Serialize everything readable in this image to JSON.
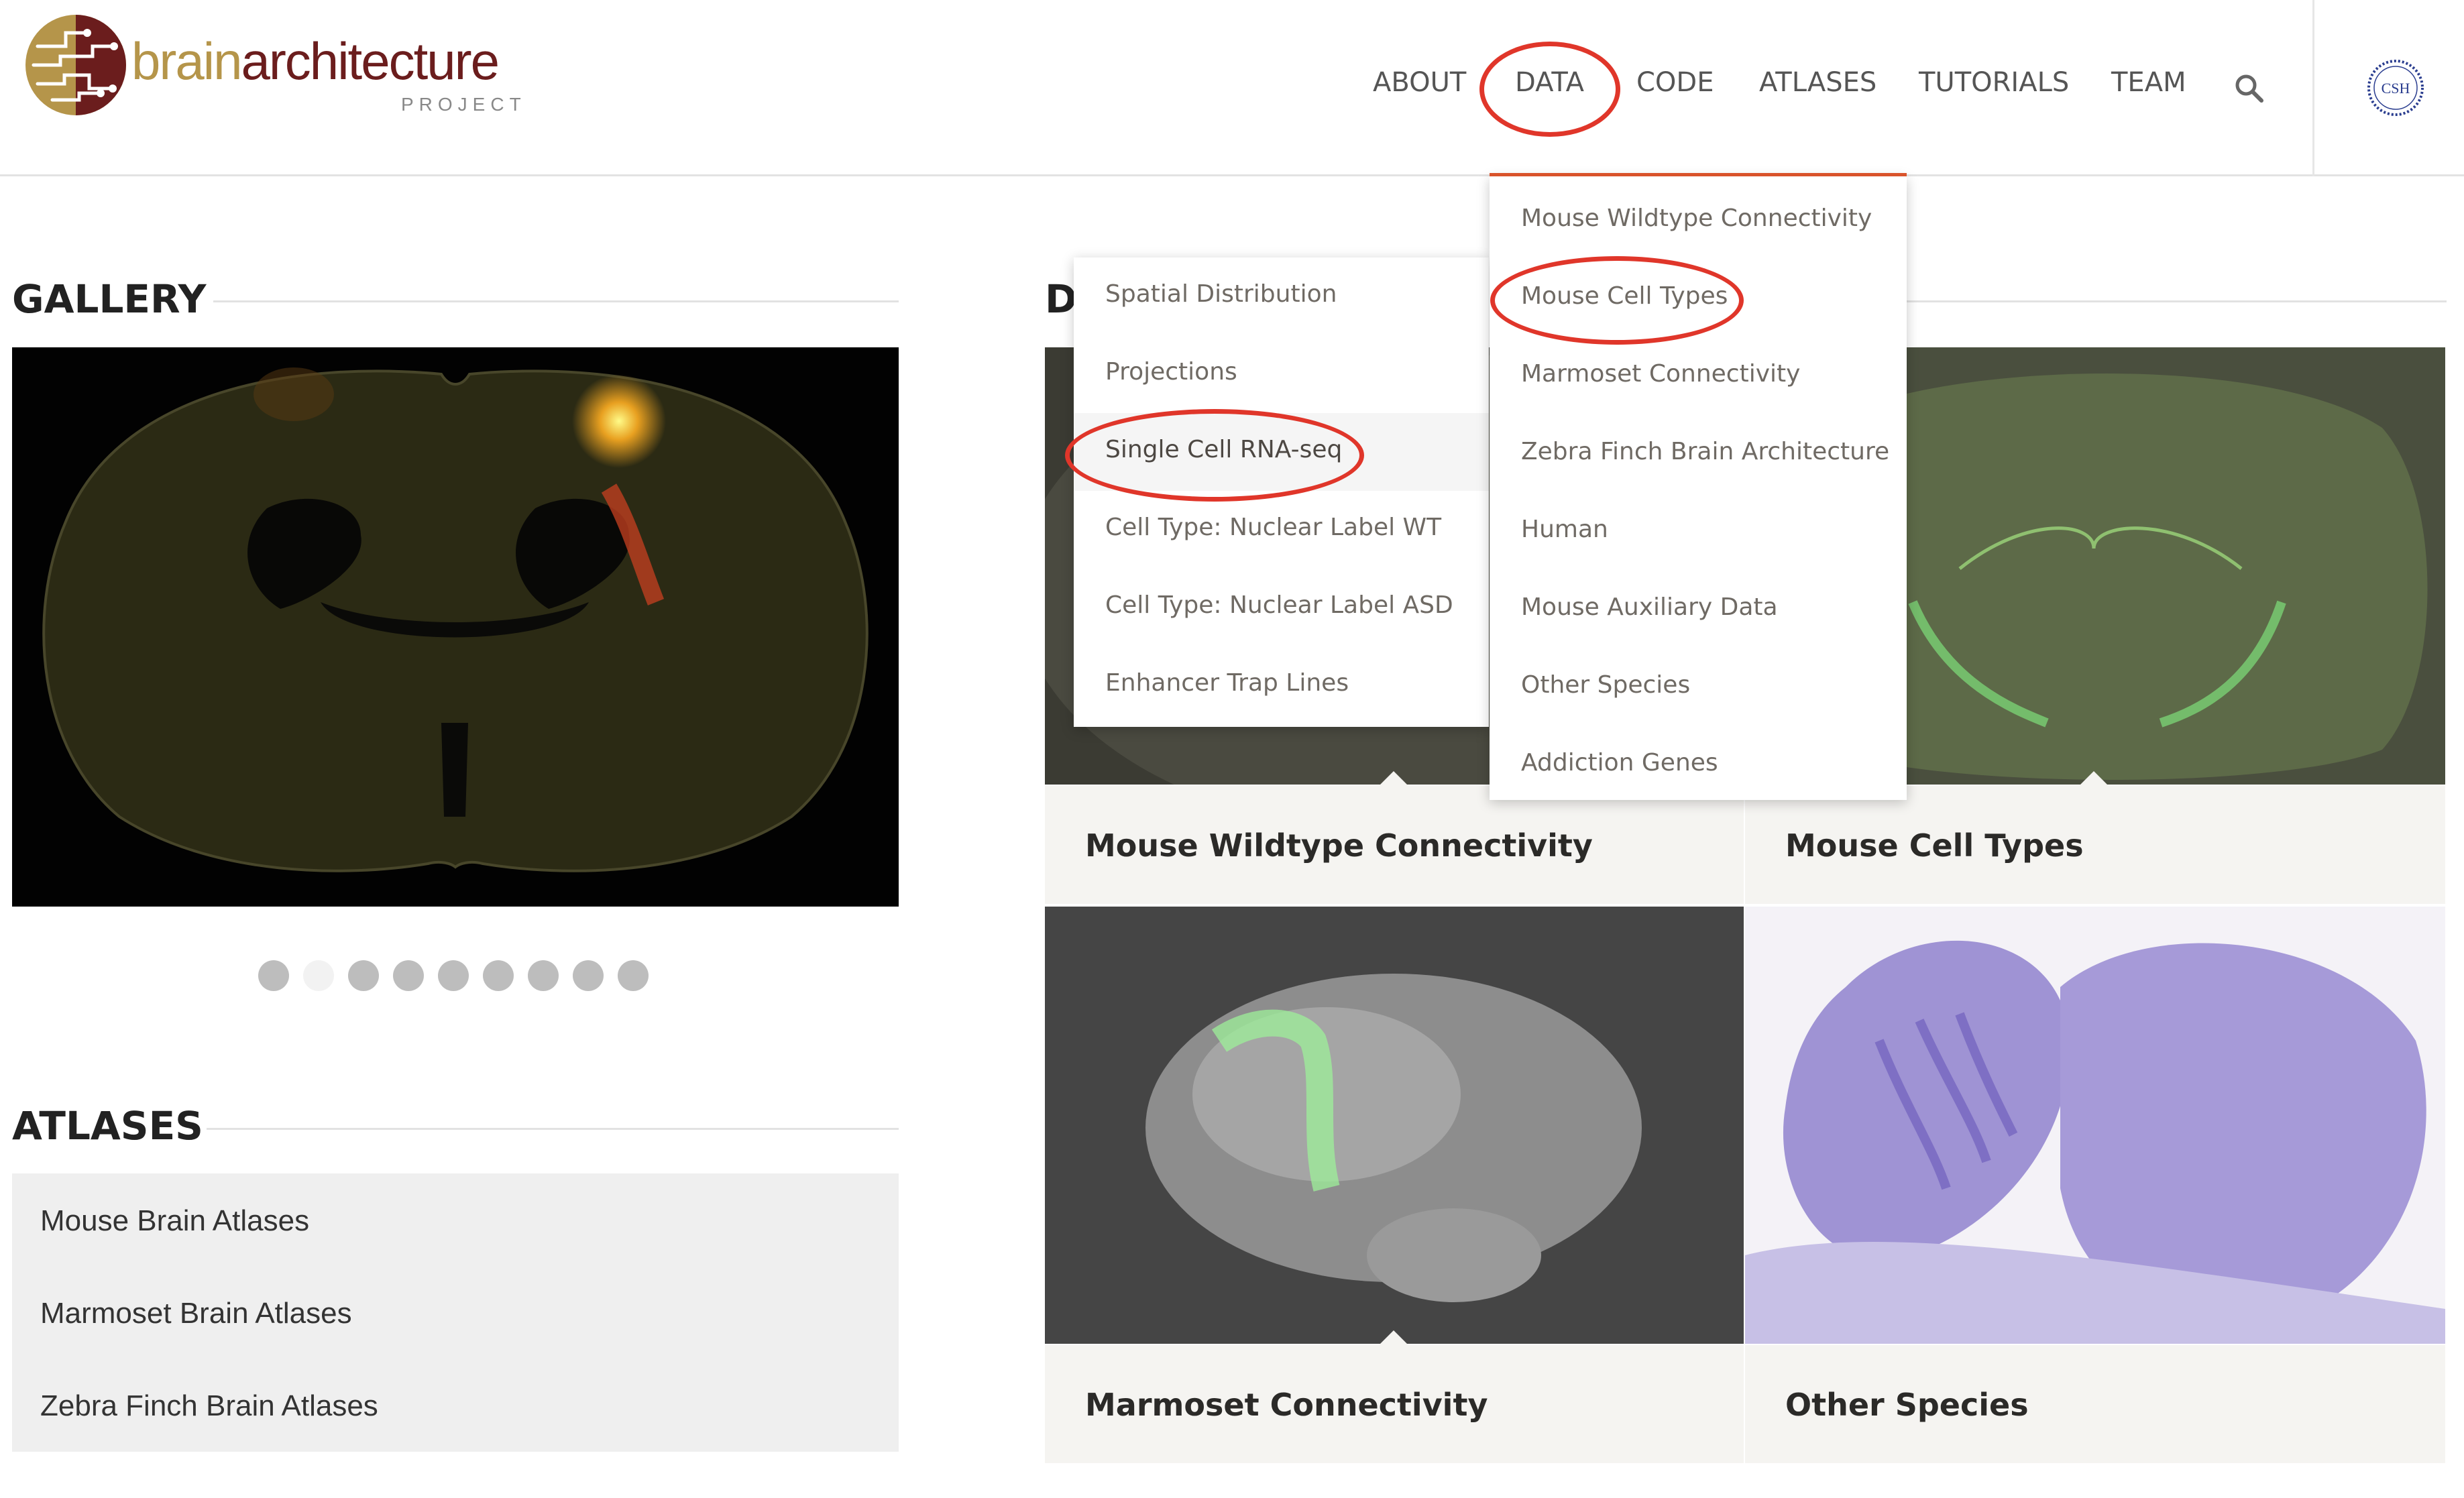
{
  "logo": {
    "brain": "brain",
    "architecture": "architecture",
    "subtitle": "PROJECT",
    "colors": {
      "gold": "#b5954a",
      "maroon": "#6b1d1d"
    }
  },
  "nav": {
    "items": [
      {
        "label": "ABOUT"
      },
      {
        "label": "DATA"
      },
      {
        "label": "CODE"
      },
      {
        "label": "ATLASES"
      },
      {
        "label": "TUTORIALS"
      },
      {
        "label": "TEAM"
      }
    ],
    "search_icon": "search-icon",
    "partner_logo": "CSH"
  },
  "gallery": {
    "title": "GALLERY",
    "dots_count": 9,
    "active_dot": 2
  },
  "atlases": {
    "title": "ATLASES",
    "links": [
      {
        "label": "Mouse Brain Atlases"
      },
      {
        "label": "Marmoset Brain Atlases"
      },
      {
        "label": "Zebra Finch Brain Atlases"
      }
    ]
  },
  "data_section": {
    "title_visible": "D",
    "tiles": [
      {
        "caption": "Mouse Wildtype Connectivity"
      },
      {
        "caption": "Mouse Cell Types"
      },
      {
        "caption": "Marmoset Connectivity"
      },
      {
        "caption": "Other Species"
      }
    ]
  },
  "data_menu": {
    "items": [
      {
        "label": "Mouse Wildtype Connectivity"
      },
      {
        "label": "Mouse Cell Types"
      },
      {
        "label": "Marmoset Connectivity"
      },
      {
        "label": "Zebra Finch Brain Architecture"
      },
      {
        "label": "Human"
      },
      {
        "label": "Mouse Auxiliary Data"
      },
      {
        "label": "Other Species"
      },
      {
        "label": "Addiction Genes"
      }
    ],
    "accent_color": "#d9532b"
  },
  "cell_types_submenu": {
    "items": [
      {
        "label": "Spatial Distribution"
      },
      {
        "label": "Projections"
      },
      {
        "label": "Single Cell RNA-seq"
      },
      {
        "label": "Cell Type: Nuclear Label WT"
      },
      {
        "label": "Cell Type: Nuclear Label ASD"
      },
      {
        "label": "Enhancer Trap Lines"
      }
    ],
    "hovered_index": 2
  },
  "annotation_color": "#e0362a"
}
